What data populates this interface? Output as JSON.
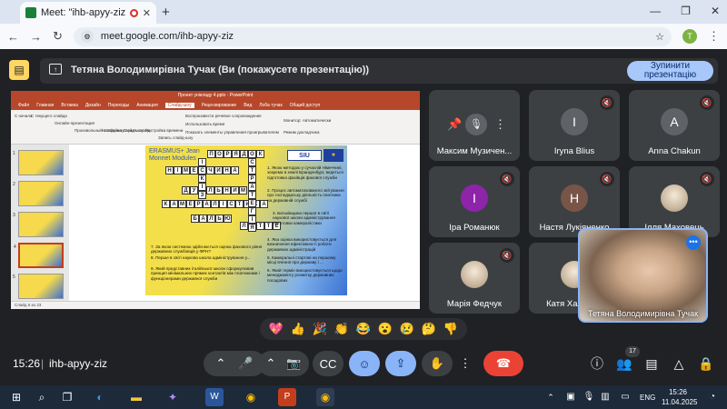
{
  "browser": {
    "tab_title": "Meet: \"ihb-apyy-ziz\"",
    "new_tab": "+",
    "url": "meet.google.com/ihb-apyy-ziz",
    "profile_initial": "T",
    "window_controls": [
      "—",
      "❐",
      "✕"
    ]
  },
  "banner": {
    "text": "Тетяна Володимирівна Тучак (Ви (покажусете презентацію))",
    "stop_button": "Зупинити презентацію"
  },
  "presentation": {
    "window_title": "Проект унікладу 4.pptx - PowerPoint",
    "ribbon_tabs": [
      "Файл",
      "Главная",
      "Вставка",
      "Дизайн",
      "Переходы",
      "Анимация",
      "Слайд-шоу",
      "Рецензирование",
      "Вид",
      "Лоба тучак",
      "Общий доступ"
    ],
    "active_tab": "Слайд-шоу",
    "ribbon_items": [
      "С начала",
      "С текущего слайда",
      "Онлайн-презентация",
      "Произвольный слайд-шоу",
      "Настройка слайд-шоу",
      "Скрыть слайд",
      "Настройка времени",
      "Запись слайд-шоу",
      "Воспроизвести речевое сопровождение",
      "Использовать время",
      "Показать элементы управления проигрывателем",
      "Монитор: Автоматически",
      "Режим докладчика"
    ],
    "slide_numbers": [
      "1",
      "2",
      "3",
      "4",
      "5"
    ],
    "status": "Слайд 5 из 23",
    "slide": {
      "erasmus": "ERASMUS+ Jean Monnet Modules",
      "siu_logo": "SIU",
      "eu_flag": "★",
      "words_h": [
        "ПОРЯДОК",
        "НІМЕЧЧИНА",
        "ДУАЛЬНИМ",
        "КАМЕРАЛІСТИКА",
        "БАЛЬЮ",
        "ЛЯТТЕ"
      ],
      "words_v": [
        "ІСКІЗ",
        "СТРАТЕГІЯ"
      ],
      "clues_right": [
        "1. Якою методою у сучасній Німеччині, зокрема в землі Бранденбург, ведеться підготовка фахівців фахової служби",
        "2. Процес автоматизованого звітування про господарську діяльність платника на державній службі",
        "3. Батьківщина першої в світі наукової школи адміністрування підготовки камералістики",
        "4. Яка оцінка використовується для визначення ефективності роботи державних адміністрацій",
        "5. Камеральні стартові на першому місці вчення про державу і ...",
        "6. Який термін використовується щодо менеджменту розвитку державних посадових"
      ],
      "clues_left": [
        "7. За якою системою здійснюється оцінка фахового рівня державних службовців у ФРН?",
        "8. Перше в світі наукова школа адміністрування у...",
        "9. Який представник італійської школи сформулював принцип мінімальних прямих контактів між платниками і функціонерами державної служби"
      ]
    }
  },
  "participants": [
    {
      "name": "Максим Музичен...",
      "initial": "",
      "color": "#3c4043",
      "pinned": true
    },
    {
      "name": "Iryna Blius",
      "initial": "I",
      "color": "#5f6368"
    },
    {
      "name": "Anna Chakun",
      "initial": "A",
      "color": "#5f6368"
    },
    {
      "name": "Іра Романюк",
      "initial": "І",
      "color": "#8e24aa"
    },
    {
      "name": "Настя Лукіяненко",
      "initial": "Н",
      "color": "#795548"
    },
    {
      "name": "Ілля Маховець",
      "initial": "",
      "color": "photo"
    },
    {
      "name": "Марія Федчук",
      "initial": "",
      "color": "photo"
    },
    {
      "name": "Катя Халімо...",
      "initial": "",
      "color": "photo"
    }
  ],
  "speaker": {
    "name": "Тетяна Володимирівна Тучак",
    "more": "•••"
  },
  "reactions": [
    "💖",
    "👍",
    "🎉",
    "👏",
    "😂",
    "😮",
    "😢",
    "🤔",
    "👎"
  ],
  "meeting": {
    "time": "15:26",
    "separator": "|",
    "code": "ihb-apyy-ziz",
    "participant_count": "17"
  },
  "taskbar": {
    "lang": "ENG",
    "time": "15:26",
    "date": "11.04.2025"
  }
}
